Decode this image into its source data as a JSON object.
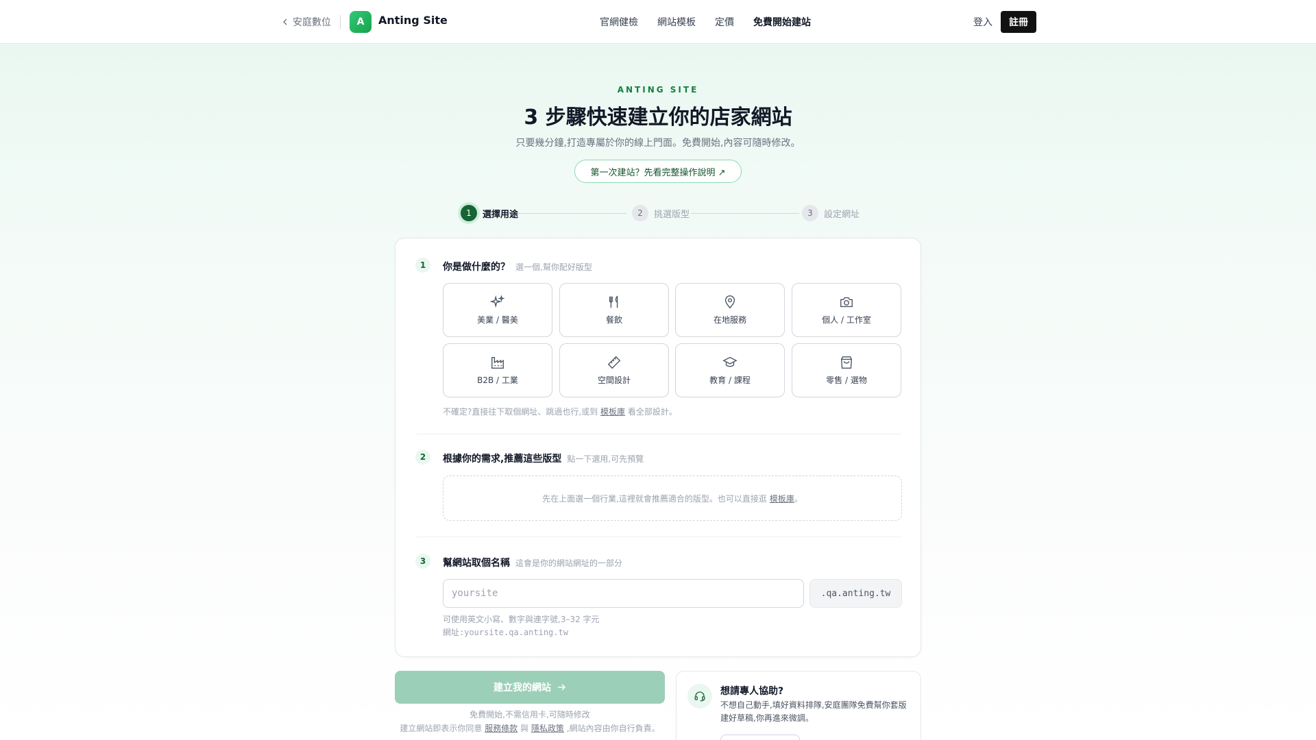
{
  "header": {
    "back_label": "安庭數位",
    "logo_letter": "A",
    "brand": "Anting Site",
    "nav": [
      "官網健檢",
      "網站模板",
      "定價",
      "免費開始建站"
    ],
    "login": "登入",
    "signup": "註冊"
  },
  "hero": {
    "eyebrow": "ANTING SITE",
    "title": "3 步驟快速建立你的店家網站",
    "subtitle": "只要幾分鐘,打造專屬於你的線上門面。免費開始,內容可隨時修改。",
    "guide_link": "第一次建站？先看完整操作說明 ↗"
  },
  "stepper": {
    "steps": [
      {
        "num": "1",
        "label": "選擇用途"
      },
      {
        "num": "2",
        "label": "挑選版型"
      },
      {
        "num": "3",
        "label": "設定網址"
      }
    ],
    "active_step": 1
  },
  "section1": {
    "num": "1",
    "title": "你是做什麼的？",
    "hint": "選一個,幫你配好版型",
    "industries": [
      {
        "label": "美業 / 醫美",
        "icon": "sparkles-icon"
      },
      {
        "label": "餐飲",
        "icon": "utensils-icon"
      },
      {
        "label": "在地服務",
        "icon": "map-pin-icon"
      },
      {
        "label": "個人 / 工作室",
        "icon": "camera-icon"
      },
      {
        "label": "B2B / 工業",
        "icon": "factory-icon"
      },
      {
        "label": "空間設計",
        "icon": "ruler-icon"
      },
      {
        "label": "教育 / 課程",
        "icon": "graduation-cap-icon"
      },
      {
        "label": "零售 / 選物",
        "icon": "shopping-bag-icon"
      }
    ],
    "note_before": "不確定?直接往下取個網址、跳過也行,或到",
    "note_link": "模板庫",
    "note_after": "看全部設計。"
  },
  "section2": {
    "num": "2",
    "title": "根據你的需求,推薦這些版型",
    "hint": "點一下選用,可先預覽",
    "empty_before": "先在上面選一個行業,這裡就會推薦適合的版型。也可以直接逛",
    "empty_link": "模板庫",
    "empty_after": "。"
  },
  "section3": {
    "num": "3",
    "title": "幫網站取個名稱",
    "hint": "這會是你的網站網址的一部分",
    "placeholder": "yoursite",
    "suffix": ".qa.anting.tw",
    "rule": "可使用英文小寫、數字與連字號,3–32 字元",
    "url_preview": "網址:yoursite.qa.anting.tw"
  },
  "cta": {
    "label": "建立我的網站",
    "note1": "免費開始,不需信用卡,可隨時修改",
    "note2_before": "建立網站即表示你同意",
    "terms": "服務條款",
    "and": "與",
    "privacy": "隱私政策",
    "note2_after": ",網站內容由你自行負責。"
  },
  "help": {
    "title": "想請專人協助?",
    "body": "不想自己動手,填好資料排隊,安庭團隊免費幫你套版建好草稿,你再進來微調。"
  },
  "colors": {
    "accent": "#166534",
    "cta_disabled": "#9ccfb8",
    "hero_bg": "#e7f6ef"
  }
}
